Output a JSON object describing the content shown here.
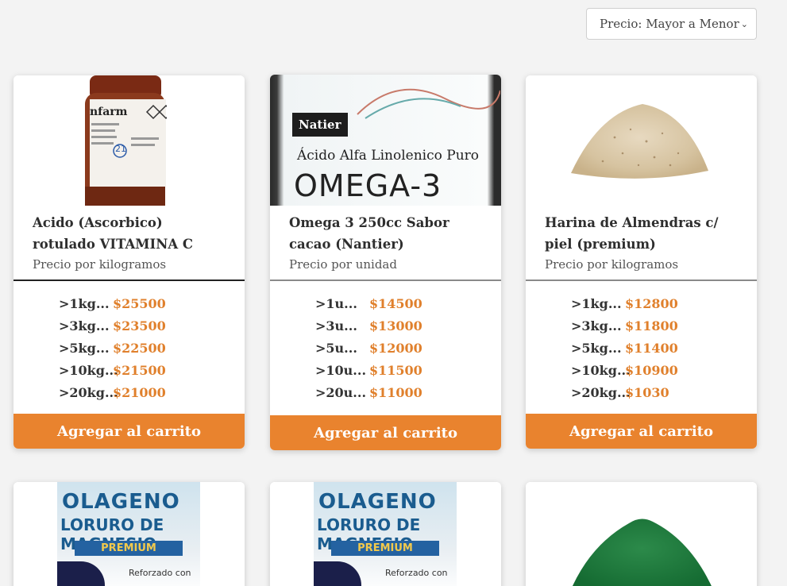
{
  "sort": {
    "selected": "Precio: Mayor a Menor"
  },
  "button_label": "Agregar al carrito",
  "colors": {
    "accent": "#e9832e",
    "price": "#e0802c"
  },
  "products": [
    {
      "name": "Acido (Ascorbico) rotulado VITAMINA C",
      "unit": "Precio por kilogramos",
      "image_text": [
        "nfarm",
        "21"
      ],
      "prices": [
        {
          "qty": ">1kg...",
          "amount": "$25500"
        },
        {
          "qty": ">3kg...",
          "amount": "$23500"
        },
        {
          "qty": ">5kg...",
          "amount": "$22500"
        },
        {
          "qty": ">10kg...",
          "amount": "$21500"
        },
        {
          "qty": ">20kg...",
          "amount": "$21000"
        }
      ]
    },
    {
      "name": "Omega 3 250cc Sabor cacao (Nantier)",
      "unit": "Precio por unidad",
      "image_text": [
        "Natier",
        "Ácido Alfa Linolenico Puro",
        "OMEGA-3"
      ],
      "prices": [
        {
          "qty": ">1u...",
          "amount": "$14500"
        },
        {
          "qty": ">3u...",
          "amount": "$13000"
        },
        {
          "qty": ">5u...",
          "amount": "$12000"
        },
        {
          "qty": ">10u...",
          "amount": "$11500"
        },
        {
          "qty": ">20u...",
          "amount": "$11000"
        }
      ]
    },
    {
      "name": "Harina de Almendras c/ piel (premium)",
      "unit": "Precio por kilogramos",
      "prices": [
        {
          "qty": ">1kg...",
          "amount": "$12800"
        },
        {
          "qty": ">3kg...",
          "amount": "$11800"
        },
        {
          "qty": ">5kg...",
          "amount": "$11400"
        },
        {
          "qty": ">10kg...",
          "amount": "$10900"
        },
        {
          "qty": ">20kg...",
          "amount": "$1030"
        }
      ]
    },
    {
      "image_text": [
        "OLAGENO",
        "LORURO DE MAGNESIO",
        "PREMIUM",
        "Reforzado con"
      ]
    },
    {
      "image_text": [
        "OLAGENO",
        "LORURO DE MAGNESIO",
        "PREMIUM",
        "Reforzado con"
      ]
    },
    {}
  ]
}
